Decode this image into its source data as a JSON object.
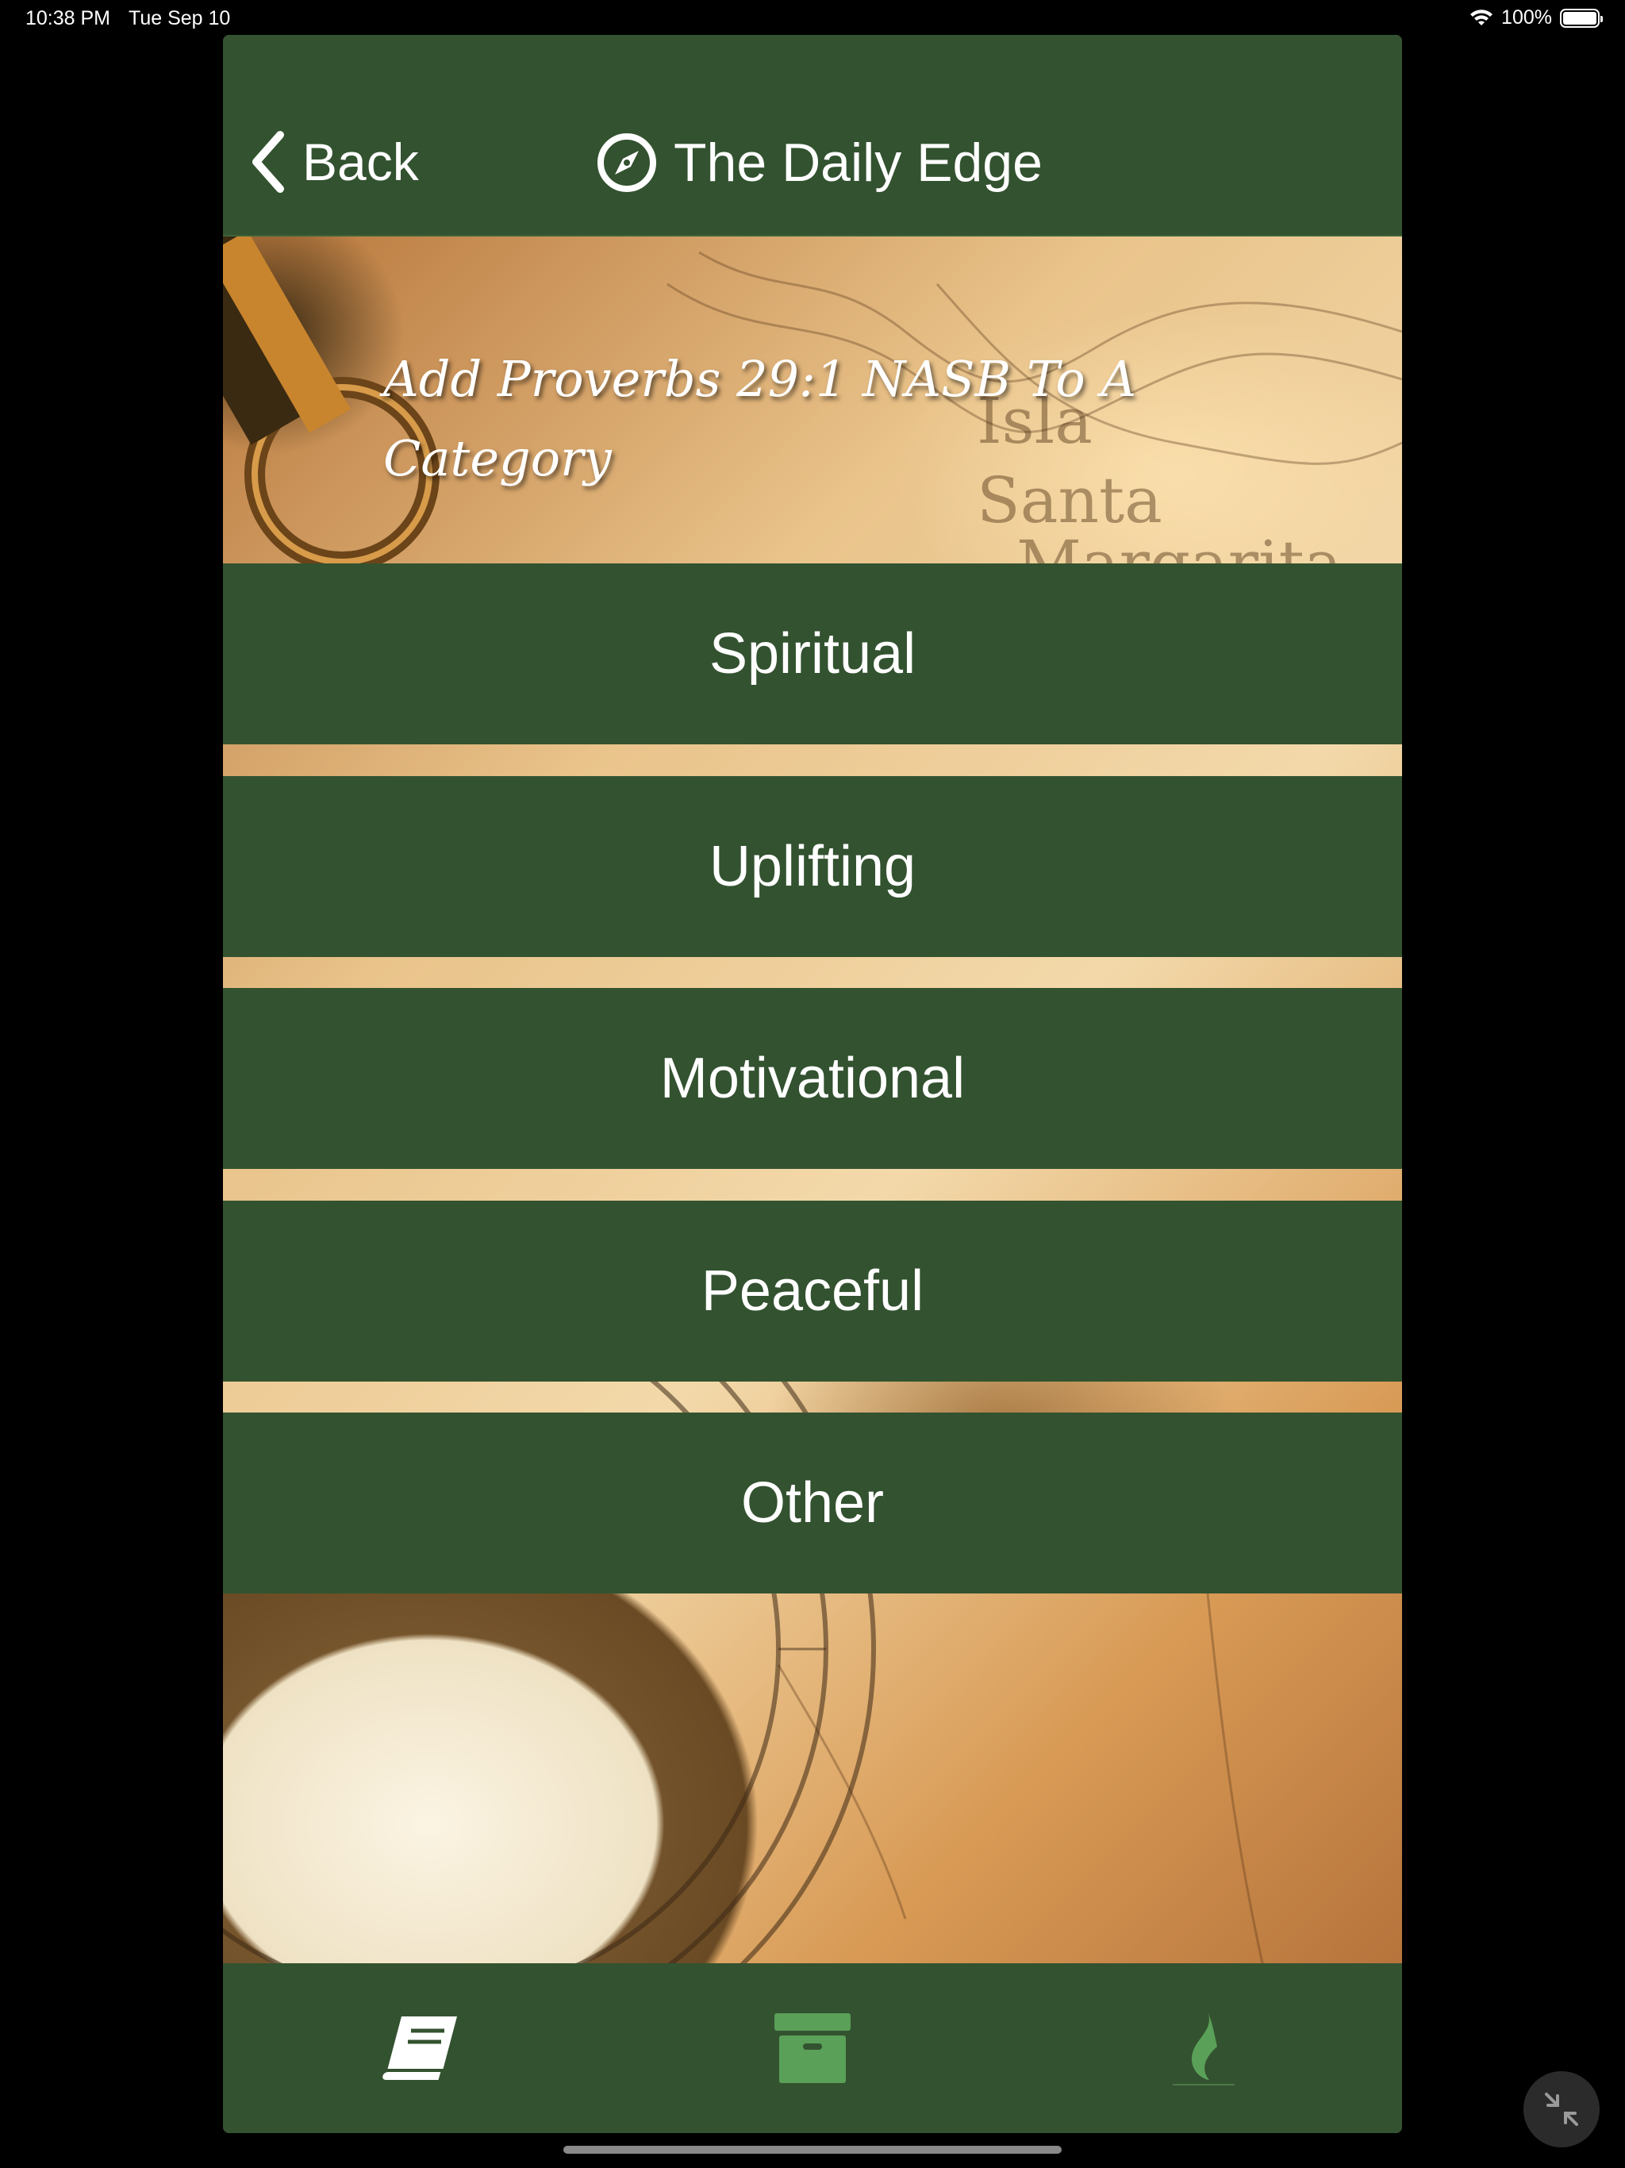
{
  "status_bar": {
    "time": "10:38 PM",
    "date": "Tue Sep 10",
    "battery": "100%"
  },
  "header": {
    "back_label": "Back",
    "title": "The Daily Edge"
  },
  "hero": {
    "title": "Add Proverbs 29:1 NASB To A Category"
  },
  "categories": [
    {
      "label": "Spiritual"
    },
    {
      "label": "Uplifting"
    },
    {
      "label": "Motivational"
    },
    {
      "label": "Peaceful"
    },
    {
      "label": "Other"
    }
  ],
  "tab_bar": {
    "tabs": [
      {
        "icon": "book-icon",
        "active": true
      },
      {
        "icon": "archive-box-icon",
        "active": false
      },
      {
        "icon": "flame-icon",
        "active": false
      }
    ]
  },
  "colors": {
    "primary_green": "#335230",
    "accent_green": "#5aa058",
    "text": "#ffffff"
  }
}
